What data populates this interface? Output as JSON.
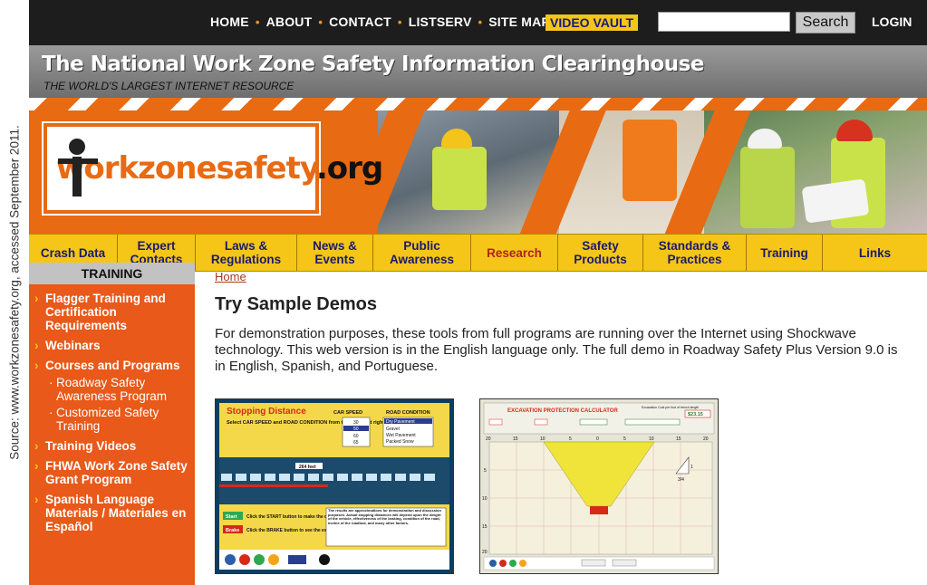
{
  "source_note": "Source: www.workzonesafety.org, accessed September 2011.",
  "topnav": {
    "links": [
      "HOME",
      "ABOUT",
      "CONTACT",
      "LISTSERV",
      "SITE MAP"
    ],
    "video_vault": "VIDEO VAULT",
    "search_placeholder": "",
    "search_button": "Search",
    "login": "LOGIN"
  },
  "header": {
    "title": "The National Work Zone Safety Information Clearinghouse",
    "tagline": "THE WORLD'S LARGEST INTERNET RESOURCE",
    "logo_main": "workzonesafety",
    "logo_suffix": ".org"
  },
  "catnav": [
    "Crash Data",
    "Expert Contacts",
    "Laws & Regulations",
    "News & Events",
    "Public Awareness",
    "Research",
    "Safety Products",
    "Standards & Practices",
    "Training",
    "Links"
  ],
  "catnav_active_index": 5,
  "sidebar": {
    "title": "TRAINING",
    "items": [
      {
        "label": "Flagger Training and Certification Requirements",
        "sub": false
      },
      {
        "label": "Webinars",
        "sub": false
      },
      {
        "label": "Courses and Programs",
        "sub": false
      },
      {
        "label": "Roadway Safety Awareness Program",
        "sub": true
      },
      {
        "label": "Customized Safety Training",
        "sub": true
      },
      {
        "label": "Training Videos",
        "sub": false
      },
      {
        "label": "FHWA Work Zone Safety Grant Program",
        "sub": false
      },
      {
        "label": "Spanish Language Materials / Materiales en Español",
        "sub": false
      }
    ]
  },
  "main": {
    "breadcrumb": "Home",
    "title": "Try Sample Demos",
    "description": "For demonstration purposes, these tools from full programs are running over the Internet using Shockwave technology.  This web version is in the English language only.  The full demo in Roadway Safety Plus Version 9.0 is in English, Spanish, and Portuguese.",
    "demo1": {
      "title": "Stopping Distance",
      "instruction": "Select CAR SPEED and ROAD CONDITION from the menus at right.",
      "col1": "CAR SPEED",
      "col2": "ROAD CONDITION",
      "speeds": [
        "20",
        "30",
        "40",
        "50",
        "60",
        "65"
      ],
      "conditions": [
        "Dry Pavement",
        "Gravel",
        "Wet Pavement",
        "Packed Snow"
      ],
      "distance": "264 feet",
      "start": "Start",
      "brake": "Brake",
      "start_text": "Click the START button to make the car go.",
      "brake_text": "Click the BRAKE button to see the estimated stopping distance.",
      "disclaimer": "The results are approximations for demonstration and discussion purposes. Actual stopping distances will depend upon the weight of the vehicle, effectiveness of the braking, condition of the road, incline of the roadbed, and many other factors."
    },
    "demo2": {
      "title": "EXCAVATION PROTECTION CALCULATOR",
      "cost_label": "Excavation Cost per foot of trench length",
      "cost_value": "$23.15",
      "x_ticks": [
        "20",
        "15",
        "10",
        "5",
        "0",
        "5",
        "10",
        "15",
        "20"
      ],
      "y_ticks": [
        "5",
        "10",
        "15",
        "20"
      ],
      "slope_label": "3/4",
      "slope_one": "1"
    }
  },
  "colors": {
    "orange": "#e8591a",
    "yellow": "#f5c518",
    "navy": "#1a1a6e",
    "dark": "#1d1d1d"
  }
}
